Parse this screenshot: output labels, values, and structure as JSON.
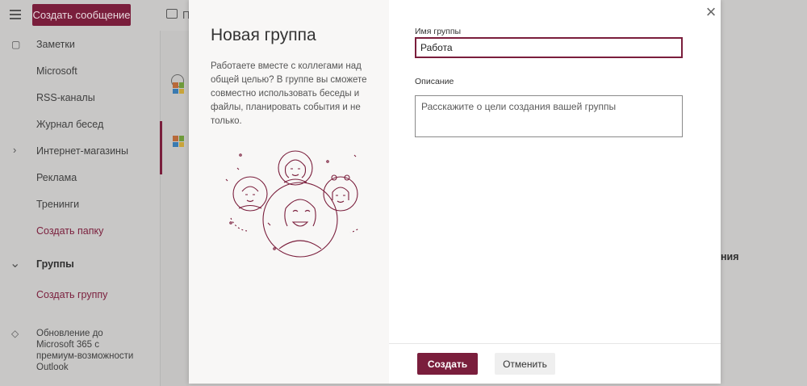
{
  "app": {
    "new_message_label": "Создать сообщение",
    "top_fragment": "П",
    "right_fragment": "ния"
  },
  "sidebar": {
    "items": [
      {
        "label": "Заметки"
      },
      {
        "label": "Microsoft"
      },
      {
        "label": "RSS-каналы"
      },
      {
        "label": "Журнал бесед"
      },
      {
        "label": "Интернет-магазины"
      },
      {
        "label": "Реклама"
      },
      {
        "label": "Тренинги"
      },
      {
        "label": "Создать папку"
      },
      {
        "label": "Группы"
      },
      {
        "label": "Создать группу"
      }
    ],
    "upgrade_text": "Обновление до Microsoft 365 с премиум-возможности Outlook"
  },
  "modal": {
    "title": "Новая группа",
    "description": "Работаете вместе с коллегами над общей целью? В группе вы сможете совместно использовать беседы и файлы, планировать события и не только.",
    "name_label": "Имя группы",
    "name_value": "Работа",
    "desc_label": "Описание",
    "desc_placeholder": "Расскажите о цели создания вашей группы",
    "create_label": "Создать",
    "cancel_label": "Отменить",
    "accent_color": "#7a1e3c"
  }
}
